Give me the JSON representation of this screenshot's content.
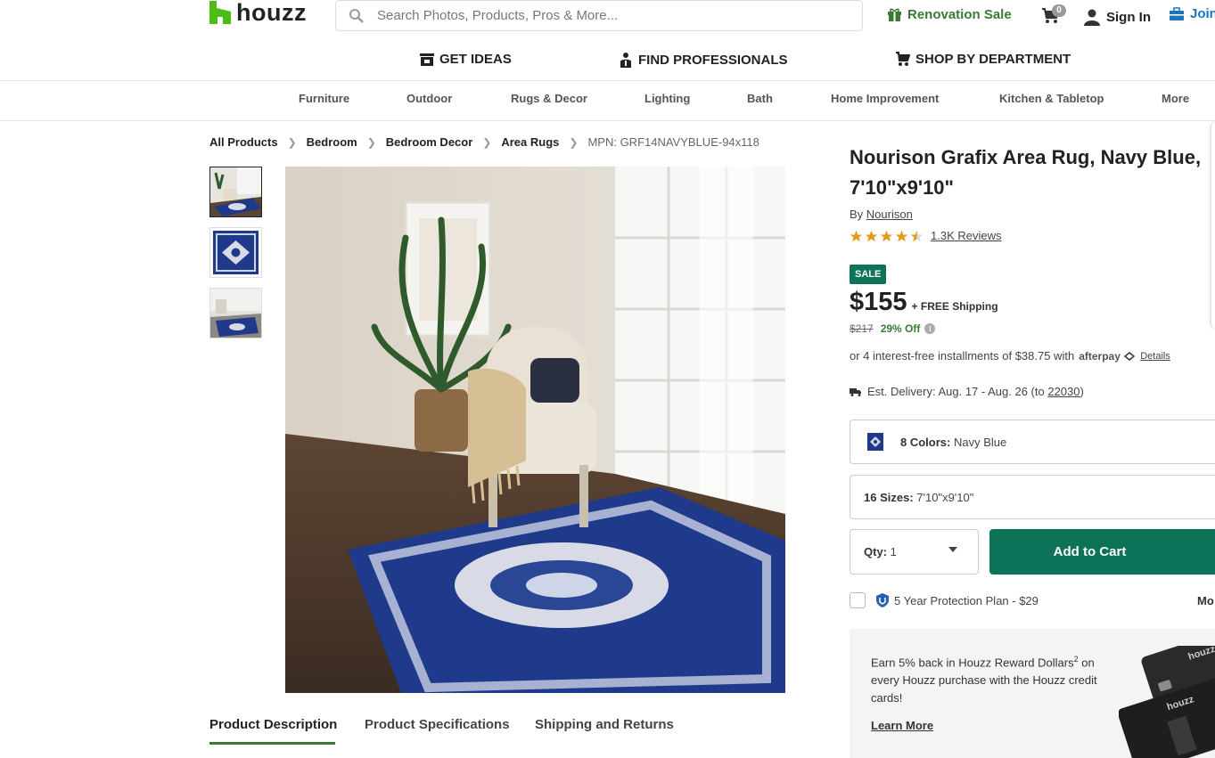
{
  "header": {
    "brand": "houzz",
    "search_placeholder": "Search Photos, Products, Pros & More...",
    "renovation_sale": "Renovation Sale",
    "cart_count": "0",
    "sign_in": "Sign In",
    "join": "Join"
  },
  "main_nav": {
    "get_ideas": "GET IDEAS",
    "find_professionals": "FIND PROFESSIONALS",
    "shop_by_department": "SHOP BY DEPARTMENT"
  },
  "categories": [
    "Furniture",
    "Outdoor",
    "Rugs & Decor",
    "Lighting",
    "Bath",
    "Home Improvement",
    "Kitchen & Tabletop",
    "More"
  ],
  "breadcrumb": {
    "items": [
      "All Products",
      "Bedroom",
      "Bedroom Decor",
      "Area Rugs"
    ],
    "mpn": "MPN: GRF14NAVYBLUE-94x118"
  },
  "tabs": [
    "Product Description",
    "Product Specifications",
    "Shipping and Returns"
  ],
  "product": {
    "title": "Nourison Grafix Area Rug, Navy Blue, 7'10\"x9'10\"",
    "by_label": "By",
    "brand": "Nourison",
    "rating": 4.5,
    "reviews": "1.3K Reviews",
    "sale_badge": "SALE",
    "price": "$155",
    "shipping": "+ FREE Shipping",
    "old_price": "$217",
    "discount": "29% Off",
    "installments": "or 4 interest-free installments of $38.75 with",
    "afterpay": "afterpay",
    "details": "Details",
    "delivery_prefix": "Est. Delivery: Aug. 17 - Aug. 26 (to",
    "delivery_zip": "22030",
    "delivery_suffix": ")",
    "colors_label": "8 Colors:",
    "colors_value": "Navy Blue",
    "sizes_label": "16 Sizes:",
    "sizes_value": "7'10\"x9'10\"",
    "qty_label": "Qty:",
    "qty_value": "1",
    "add_to_cart": "Add to Cart",
    "protection": "5 Year Protection Plan - $29",
    "more": "Mo"
  },
  "promo": {
    "line1": "Earn 5% back in Houzz Reward Dollars",
    "sup": "2",
    "line2": "on every Houzz purchase with the Houzz credit cards!",
    "learn_more": "Learn More",
    "card_brand": "houzz"
  },
  "colors": {
    "brand_green": "#3b7a35",
    "cta_green": "#0c7358",
    "join_blue": "#1c75bc",
    "rug_navy": "#1f3a8a"
  }
}
